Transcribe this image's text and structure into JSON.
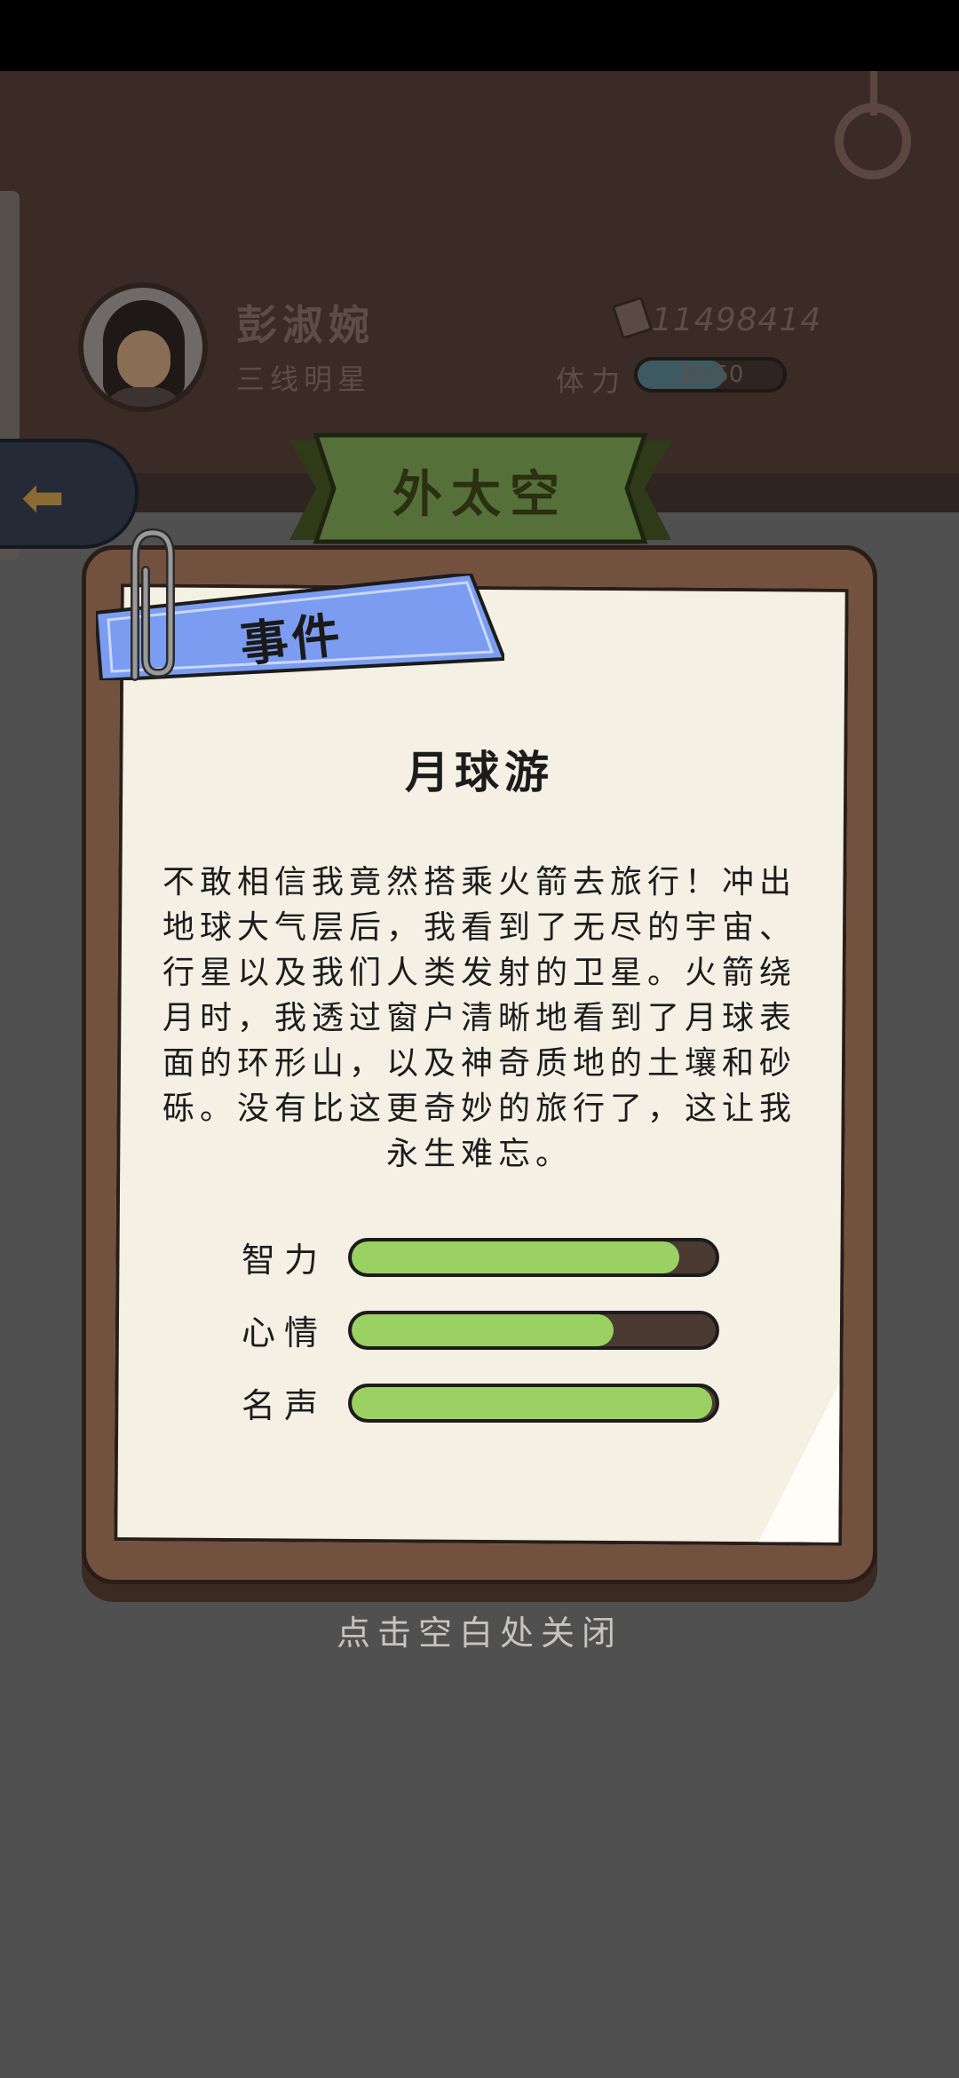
{
  "player": {
    "name": "彭淑婉",
    "title": "三线明星",
    "money": "11498414",
    "energy_label": "体力",
    "energy_text": "30/50",
    "energy_fraction": 0.6
  },
  "location_banner": "外太空",
  "ribbon_label": "事件",
  "event": {
    "title": "月球游",
    "description": "不敢相信我竟然搭乘火箭去旅行！冲出地球大气层后，我看到了无尽的宇宙、行星以及我们人类发射的卫星。火箭绕月时，我透过窗户清晰地看到了月球表面的环形山，以及神奇质地的土壤和砂砾。没有比这更奇妙的旅行了，这让我永生难忘。"
  },
  "stats": [
    {
      "label": "智力",
      "fraction": 0.9
    },
    {
      "label": "心情",
      "fraction": 0.72
    },
    {
      "label": "名声",
      "fraction": 0.99
    }
  ],
  "close_hint": "点击空白处关闭",
  "icons": {
    "back": "arrow-left-icon",
    "money": "banknote-icon",
    "clip": "paperclip-icon"
  },
  "colors": {
    "header_bg": "#3a2b26",
    "banner_green": "#56703a",
    "ribbon_blue": "#7b9cf0",
    "stat_fill": "#9bd162",
    "board_brown": "#72513f",
    "paper": "#f4f0e4"
  }
}
